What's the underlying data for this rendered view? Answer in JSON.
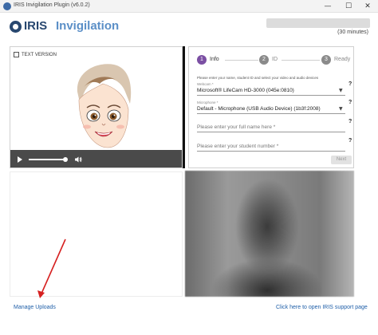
{
  "window": {
    "title": "IRIS Invigilation Plugin (v6.0.2)",
    "controls": [
      "—",
      "☐",
      "✕"
    ]
  },
  "header": {
    "logo_part1": "IRIS",
    "logo_part2": "Invigilation",
    "duration": "(30 minutes)"
  },
  "video": {
    "text_version_label": "TEXT VERSION",
    "progress_fraction": 0.9
  },
  "stepper": {
    "steps": [
      {
        "number": "1",
        "label": "Info",
        "active": true
      },
      {
        "number": "2",
        "label": "ID",
        "active": false
      },
      {
        "number": "3",
        "label": "Ready",
        "active": false
      }
    ],
    "active_color": "#7b4fa3",
    "inactive_color": "#8a8a8a"
  },
  "form": {
    "instructions": "Please enter your name, student ID and select your video and audio devices",
    "webcam_label": "Webcam *",
    "webcam_value": "Microsoft® LifeCam HD-3000 (045e:0810)",
    "microphone_label": "Microphone *",
    "microphone_value": "Default - Microphone (USB Audio Device) (1b3f:2008)",
    "name_placeholder": "Please enter your full name here *",
    "student_number_placeholder": "Please enter your student number *",
    "help": "?",
    "next_label": "Next"
  },
  "footer": {
    "manage_uploads": "Manage Uploads",
    "support_link": "Click here to open IRIS support page"
  },
  "colors": {
    "link": "#1f5fa8",
    "annotation_arrow": "#d62020"
  }
}
